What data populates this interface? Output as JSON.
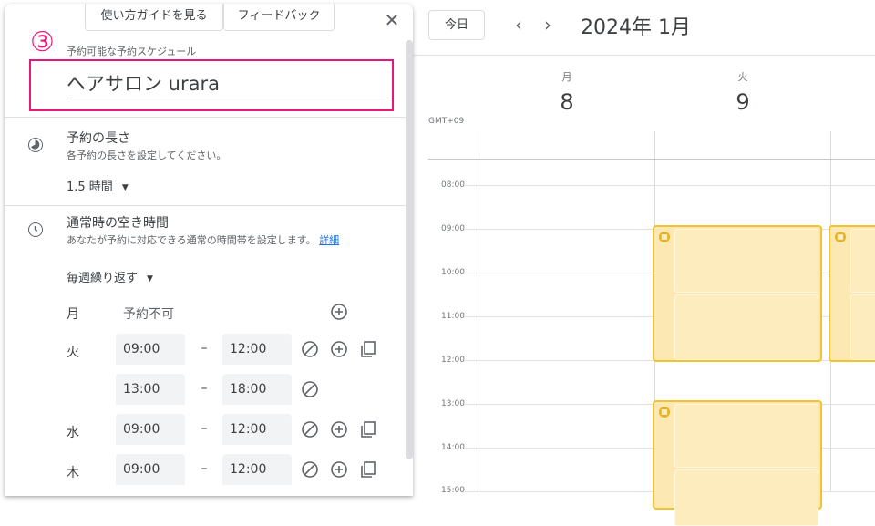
{
  "panel": {
    "guide_button": "使い方ガイドを見る",
    "feedback_button": "フィードバック",
    "close_glyph": "✕",
    "step_marker": "③",
    "schedule_label": "予約可能な予約スケジュール",
    "schedule_title": "ヘアサロン urara",
    "duration": {
      "title": "予約の長さ",
      "subtitle": "各予約の長さを設定してください。",
      "value": "1.5 時間"
    },
    "availability": {
      "title": "通常時の空き時間",
      "subtitle": "あなたが予約に対応できる通常の時間帯を設定します。",
      "link": "詳細",
      "repeat": "毎週繰り返す"
    },
    "days": [
      {
        "label": "月",
        "unavailable": "予約不可"
      },
      {
        "label": "火",
        "ranges": [
          {
            "start": "09:00",
            "end": "12:00"
          },
          {
            "start": "13:00",
            "end": "18:00"
          }
        ]
      },
      {
        "label": "水",
        "ranges": [
          {
            "start": "09:00",
            "end": "12:00"
          }
        ]
      },
      {
        "label": "木",
        "ranges": [
          {
            "start": "09:00",
            "end": "12:00"
          }
        ]
      }
    ],
    "dash": "–"
  },
  "calendar": {
    "today_button": "今日",
    "prev_glyph": "‹",
    "next_glyph": "›",
    "month_title": "2024年 1月",
    "timezone": "GMT+09",
    "columns": [
      {
        "day_name": "月",
        "day_number": "8"
      },
      {
        "day_name": "火",
        "day_number": "9"
      }
    ],
    "hours": [
      "08:00",
      "09:00",
      "10:00",
      "11:00",
      "12:00",
      "13:00",
      "14:00",
      "15:00"
    ]
  },
  "colors": {
    "accent_pink": "#e6197a",
    "slot_fill": "#fce8b2",
    "slot_border": "#f2c230",
    "link_blue": "#1a73e8"
  }
}
